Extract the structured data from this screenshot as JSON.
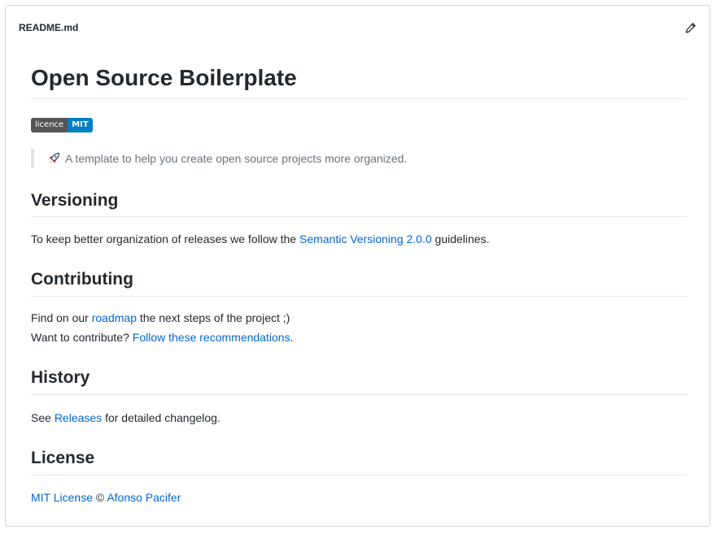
{
  "readme": {
    "filename": "README.md",
    "edit_icon": "pencil-icon"
  },
  "title": "Open Source Boilerplate",
  "badge": {
    "label": "licence",
    "value": "MIT",
    "label_color": "#555555",
    "value_color": "#007ec6"
  },
  "tagline": {
    "icon": "rocket-icon",
    "text": "A template to help you create open source projects more organized."
  },
  "sections": {
    "versioning": {
      "heading": "Versioning",
      "before": "To keep better organization of releases we follow the ",
      "link": "Semantic Versioning 2.0.0",
      "after": " guidelines."
    },
    "contributing": {
      "heading": "Contributing",
      "line1_before": "Find on our ",
      "line1_link": "roadmap",
      "line1_after": " the next steps of the project ;)",
      "line2_before": "Want to contribute? ",
      "line2_link": "Follow these recommendations",
      "line2_after": "."
    },
    "history": {
      "heading": "History",
      "before": "See ",
      "link": "Releases",
      "after": " for detailed changelog."
    },
    "license": {
      "heading": "License",
      "link1": "MIT License",
      "middle": " © ",
      "link2": "Afonso Pacifer"
    }
  },
  "colors": {
    "link": "#0366d6",
    "text": "#24292e",
    "muted": "#6a737d",
    "border": "#d1d5da"
  }
}
